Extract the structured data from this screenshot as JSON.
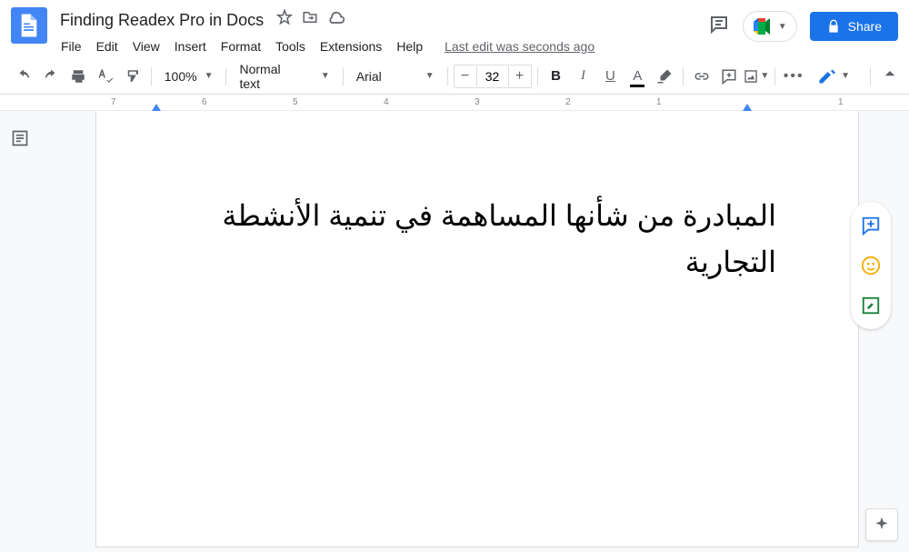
{
  "header": {
    "doc_title": "Finding Readex Pro in Docs",
    "share_label": "Share",
    "last_edit": "Last edit was seconds ago"
  },
  "menubar": {
    "items": [
      "File",
      "Edit",
      "View",
      "Insert",
      "Format",
      "Tools",
      "Extensions",
      "Help"
    ]
  },
  "toolbar": {
    "zoom": "100%",
    "paragraph_style": "Normal text",
    "font_family": "Arial",
    "font_size": "32"
  },
  "ruler": {
    "marks": [
      "7",
      "6",
      "5",
      "4",
      "3",
      "2",
      "1",
      "",
      "1"
    ]
  },
  "document": {
    "content": "المبادرة من شأنها المساهمة في تنمية الأنشطة التجارية"
  },
  "colors": {
    "primary": "#1a73e8",
    "text_color_indicator": "#000000",
    "highlight_indicator": "#ffffff"
  }
}
